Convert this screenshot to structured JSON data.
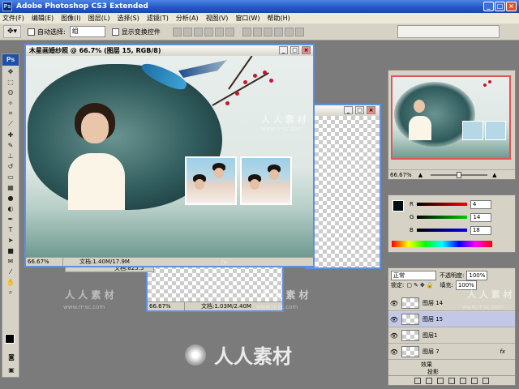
{
  "app": {
    "title": "Adobe Photoshop CS3 Extended",
    "logo": "Ps"
  },
  "menu": [
    "文件(F)",
    "编辑(E)",
    "图像(I)",
    "图层(L)",
    "选择(S)",
    "滤镜(T)",
    "分析(A)",
    "视图(V)",
    "窗口(W)",
    "帮助(H)"
  ],
  "options": {
    "auto_select_label": "自动选择:",
    "auto_select_value": "组",
    "show_transform_label": "显示变换控件"
  },
  "doc_main": {
    "title": "木星画婚纱照 @ 66.7% (图层 15, RGB/8)",
    "zoom": "66.67%",
    "size": "文档:1.40M/17.9M"
  },
  "doc_back": {
    "zoom": "66.67%",
    "size": "文档:1.03M/2.40M"
  },
  "doc_mid": {
    "zoom": "66.67%",
    "size": "文档:825.5"
  },
  "navigator": {
    "zoom": "66.67%"
  },
  "color": {
    "r_label": "R",
    "g_label": "G",
    "b_label": "B",
    "r": "4",
    "g": "14",
    "b": "18",
    "fg": "#040e12"
  },
  "layers": {
    "mode": "正常",
    "opacity_label": "不透明度:",
    "opacity": "100%",
    "lock_label": "锁定:",
    "fill_label": "填充:",
    "fill": "100%",
    "rows": [
      {
        "name": "图层 14",
        "selected": false
      },
      {
        "name": "图层 15",
        "selected": true
      },
      {
        "name": "图层1",
        "selected": false
      },
      {
        "name": "图层 7",
        "selected": false
      }
    ],
    "effects_label": "效果",
    "shadow_label": "投影",
    "fx": "fx"
  },
  "watermark": {
    "text": "人人素材",
    "small": "人 人 素 材",
    "url": "www.rr-sc.com"
  }
}
